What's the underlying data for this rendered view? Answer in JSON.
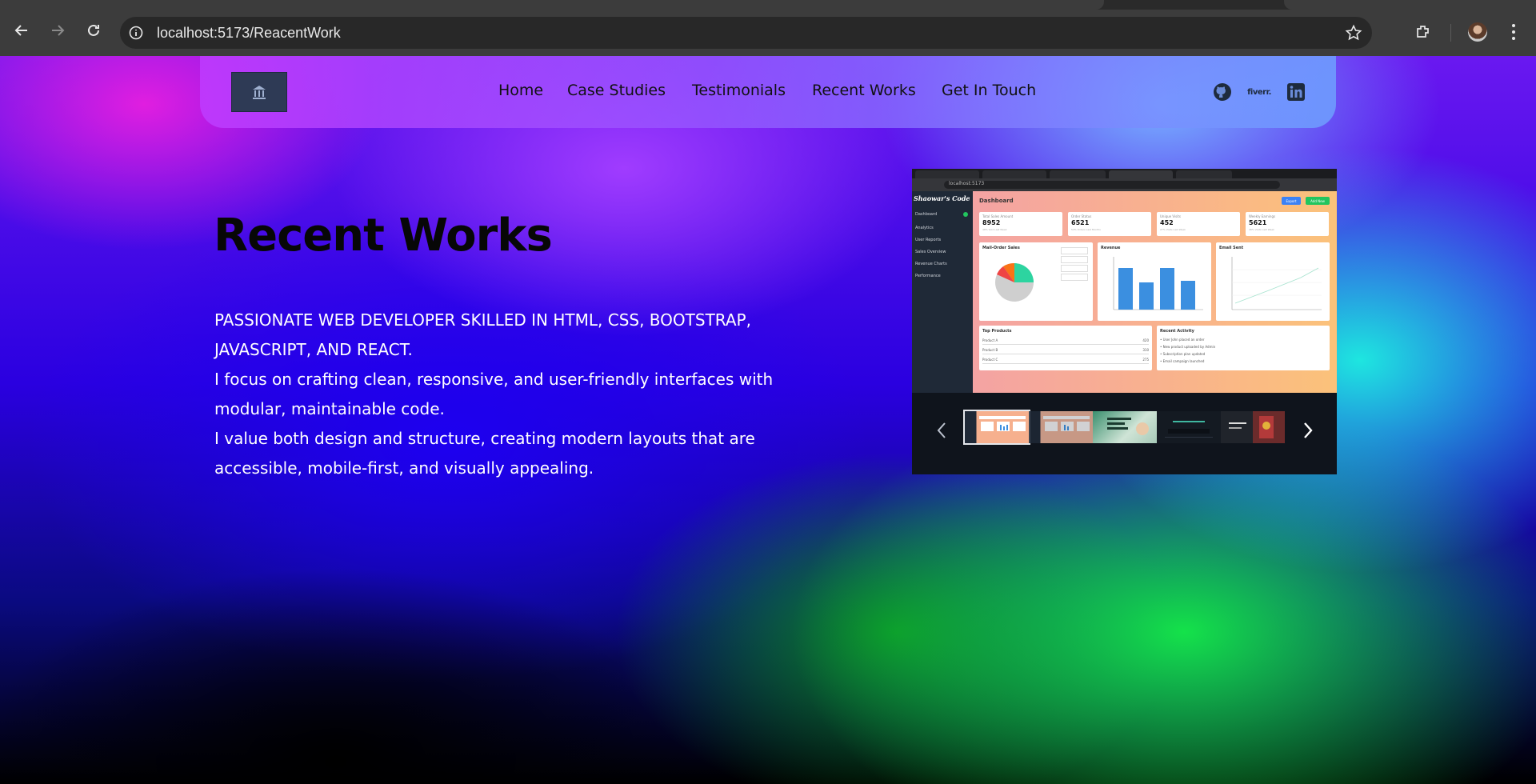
{
  "browser": {
    "url": "localhost:5173/ReacentWork"
  },
  "site": {
    "nav": [
      "Home",
      "Case Studies",
      "Testimonials",
      "Recent Works",
      "Get In Touch"
    ],
    "social": [
      {
        "name": "github-icon"
      },
      {
        "name": "fiverr-icon",
        "label": "fiverr."
      },
      {
        "name": "linkedin-icon"
      }
    ]
  },
  "hero": {
    "title": "Recent Works",
    "lines": [
      "PASSIONATE WEB DEVELOPER SKILLED IN HTML, CSS, BOOTSTRAP,",
      "JAVASCRIPT, AND REACT.",
      "I focus on crafting clean, responsive, and user-friendly interfaces with",
      "modular, maintainable code.",
      "I value both design and structure, creating modern layouts that are",
      "accessible, mobile-first, and visually appealing."
    ]
  },
  "preview": {
    "address": "localhost:5173",
    "brand": "Shaowar's Code",
    "sidebar": [
      "Dashboard",
      "Analytics",
      "User Reports",
      "Sales Overview",
      "Revenue Charts",
      "Performance"
    ],
    "page_title": "Dashboard",
    "buttons": [
      "Export",
      "Add New"
    ],
    "stats": [
      {
        "label": "Total Sales Amount",
        "value": "8952",
        "sub": "48% Sold Last Week"
      },
      {
        "label": "Order Status",
        "value": "6521",
        "sub": "54% Orders Last Months"
      },
      {
        "label": "Unique Visits",
        "value": "452",
        "sub": "27% Visits Last Week"
      },
      {
        "label": "Weekly Earnings",
        "value": "5621",
        "sub": "48% Visits Last Week"
      }
    ],
    "panels": [
      "Mail-Order Sales",
      "Revenue",
      "Email Sent"
    ],
    "top_products": {
      "title": "Top Products",
      "rows": [
        {
          "name": "Product A",
          "value": "420"
        },
        {
          "name": "Product B",
          "value": "310"
        },
        {
          "name": "Product C",
          "value": "275"
        }
      ]
    },
    "activity": {
      "title": "Recent Activity",
      "items": [
        "User John placed an order",
        "New product uploaded by Admin",
        "Subscription plan updated",
        "Email campaign launched"
      ]
    }
  },
  "colors": {
    "nav_text": "#111111",
    "title": "#070707",
    "body_text": "#ffffff",
    "accent_blue": "#3b82f6",
    "accent_green": "#22c55e"
  }
}
